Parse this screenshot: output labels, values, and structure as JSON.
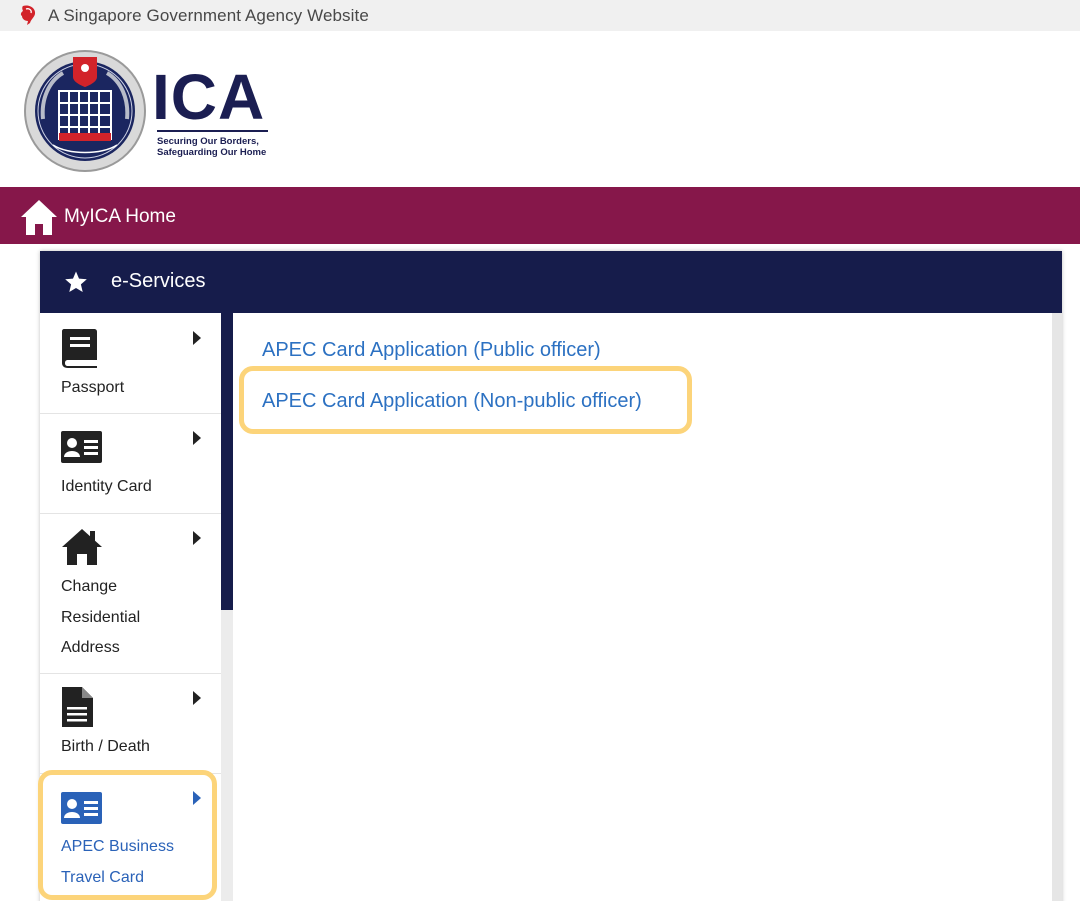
{
  "gov_bar": {
    "text": "A Singapore Government Agency Website",
    "icon": "lion-head-icon"
  },
  "header": {
    "logo_text": "ICA",
    "tagline_line1": "Securing Our Borders,",
    "tagline_line2": "Safeguarding Our Home",
    "crest_ring_text": "IMMIGRATION & CHECKPOINTS AUTHORITY SINGAPORE"
  },
  "nav": {
    "home_label": "MyICA Home",
    "home_icon": "home-icon",
    "bg_color": "#86174a"
  },
  "panel": {
    "title": "e-Services",
    "title_icon": "star-icon",
    "header_color": "#161c4b"
  },
  "sidebar": {
    "items": [
      {
        "label": "Passport",
        "icon": "book-icon"
      },
      {
        "label": "Identity Card",
        "icon": "id-card-icon"
      },
      {
        "label_lines": [
          "Change",
          "Residential",
          "Address"
        ],
        "icon": "home-icon"
      },
      {
        "label": "Birth / Death",
        "icon": "document-icon"
      },
      {
        "label_lines": [
          "APEC Business",
          "Travel Card"
        ],
        "icon": "business-card-icon",
        "active": true
      }
    ]
  },
  "content": {
    "links": [
      {
        "label": "APEC Card Application (Public officer)"
      },
      {
        "label": "APEC Card Application (Non-public officer)",
        "highlighted": true
      }
    ],
    "link_color": "#2c71c2"
  },
  "highlight_color": "#fcd47a"
}
